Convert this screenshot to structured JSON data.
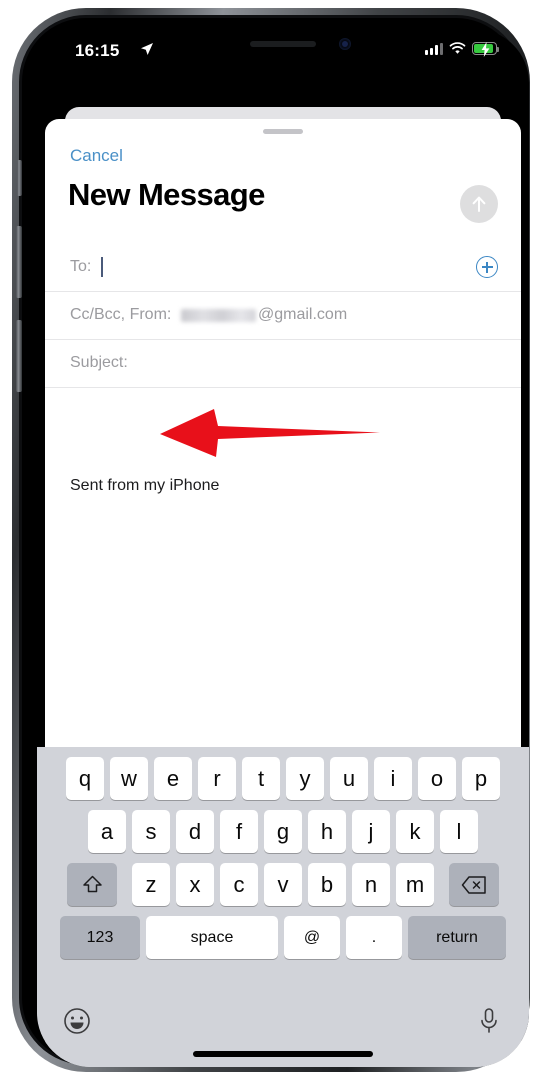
{
  "status_bar": {
    "time": "16:15",
    "location_icon": "location-arrow-icon",
    "signal_icon": "cellular-signal-icon",
    "wifi_icon": "wifi-icon",
    "battery_icon": "battery-charging-icon",
    "battery_color": "#37c93f"
  },
  "compose": {
    "cancel_label": "Cancel",
    "title": "New Message",
    "send_icon": "send-arrow-up-icon",
    "accent_color": "#3c87c4",
    "fields": {
      "to_label": "To:",
      "to_value": "",
      "ccbcc_label": "Cc/Bcc, From:",
      "from_address_visible": "@gmail.com",
      "from_username_redacted": true,
      "subject_label": "Subject:",
      "subject_value": "",
      "add_contact_icon": "add-contact-plus-icon"
    },
    "body": {
      "signature": "Sent from my iPhone"
    }
  },
  "annotation": {
    "arrow_icon": "red-left-arrow-annotation",
    "color": "#e8101a",
    "direction": "left"
  },
  "keyboard": {
    "row1": [
      "q",
      "w",
      "e",
      "r",
      "t",
      "y",
      "u",
      "i",
      "o",
      "p"
    ],
    "row2": [
      "a",
      "s",
      "d",
      "f",
      "g",
      "h",
      "j",
      "k",
      "l"
    ],
    "row3": [
      "z",
      "x",
      "c",
      "v",
      "b",
      "n",
      "m"
    ],
    "shift_icon": "shift-arrow-up-icon",
    "backspace_icon": "backspace-delete-icon",
    "numbers_label": "123",
    "space_label": "space",
    "at_label": "@",
    "period_label": ".",
    "return_label": "return",
    "emoji_icon": "emoji-smiley-icon",
    "dictation_icon": "microphone-icon"
  }
}
